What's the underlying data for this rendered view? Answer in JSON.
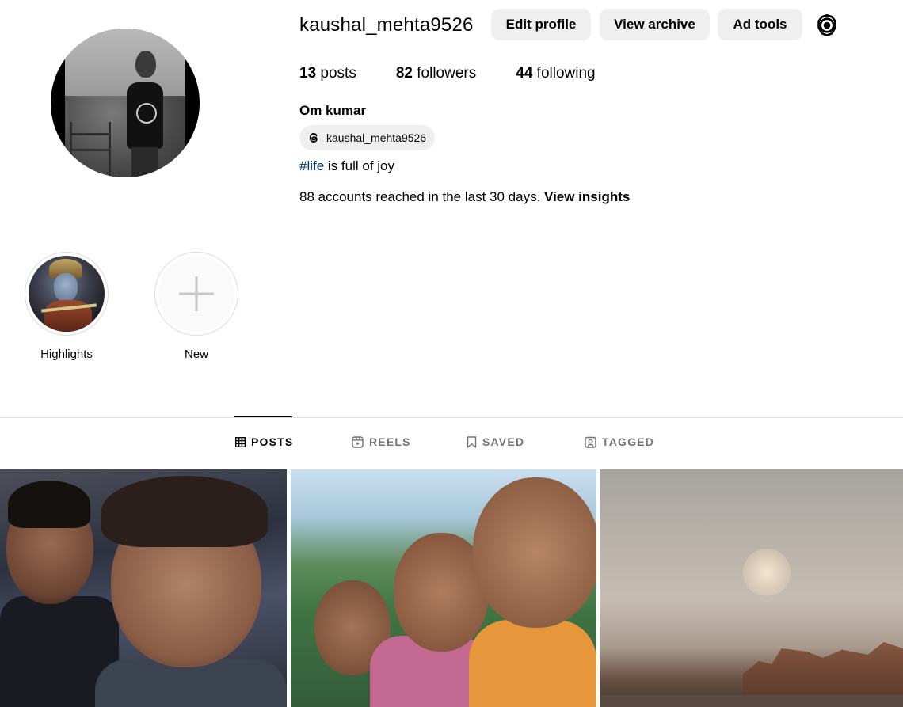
{
  "profile": {
    "username": "kaushal_mehta9526",
    "full_name": "Om kumar",
    "threads_handle": "kaushal_mehta9526",
    "bio_hashtag": "#life",
    "bio_text": " is full of joy",
    "insights_text": "88 accounts reached in the last 30 days. ",
    "insights_link": "View insights"
  },
  "actions": {
    "edit_profile": "Edit profile",
    "view_archive": "View archive",
    "ad_tools": "Ad tools"
  },
  "stats": {
    "posts_count": "13",
    "posts_label": "posts",
    "followers_count": "82",
    "followers_label": "followers",
    "following_count": "44",
    "following_label": "following"
  },
  "highlights": [
    {
      "label": "Highlights"
    },
    {
      "label": "New"
    }
  ],
  "tabs": [
    {
      "label": "POSTS",
      "active": true
    },
    {
      "label": "REELS",
      "active": false
    },
    {
      "label": "SAVED",
      "active": false
    },
    {
      "label": "TAGGED",
      "active": false
    }
  ],
  "icons": {
    "settings": "gear-icon",
    "threads": "threads-icon",
    "posts_tab": "grid-icon",
    "reels_tab": "reels-icon",
    "saved_tab": "bookmark-icon",
    "tagged_tab": "tag-icon",
    "new_highlight": "plus-icon"
  },
  "colors": {
    "button_bg": "#efefef",
    "hashtag": "#00376b",
    "muted_tab": "#737373",
    "divider": "#dbdbdb"
  }
}
